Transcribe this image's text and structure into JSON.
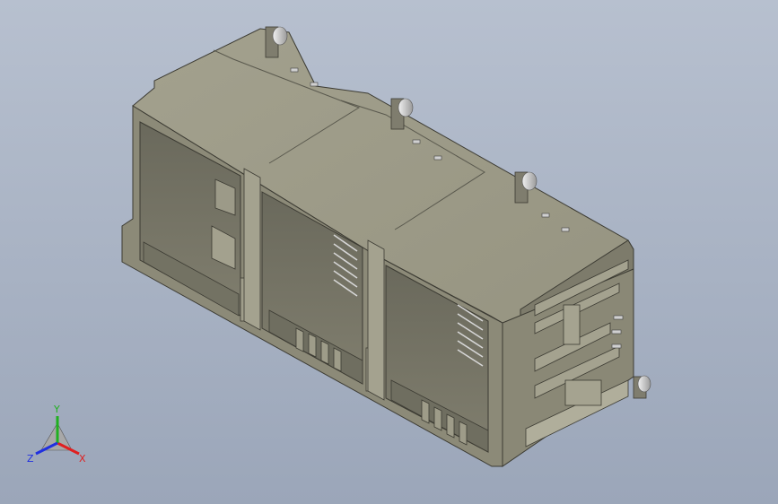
{
  "viewport": {
    "background_top": "#b7c0cf",
    "background_bottom": "#9ba6b9"
  },
  "model": {
    "body_color": "#8e8c7a",
    "top_color": "#a09e8b",
    "dark_color": "#5e5d51",
    "pin_color": "#c9c9c9"
  },
  "triad": {
    "x_label": "X",
    "y_label": "Y",
    "z_label": "Z",
    "x_color": "#e02020",
    "y_color": "#20b020",
    "z_color": "#2030e0"
  }
}
